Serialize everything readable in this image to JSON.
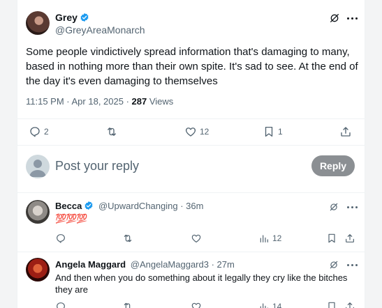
{
  "main_post": {
    "display_name": "Grey",
    "handle": "@GreyAreaMonarch",
    "text": "Some people vindictively spread information that's damaging to many, based in nothing more than their own spite. It's sad to see. At the end of the day it's even damaging to themselves",
    "timestamp": "11:15 PM · Apr 18, 2025 · ",
    "views_count": "287",
    "views_label": " Views",
    "replies": "2",
    "reposts": "",
    "likes": "12",
    "bookmarks": "1"
  },
  "reply_box": {
    "placeholder": "Post your reply",
    "button_label": "Reply"
  },
  "replies": [
    {
      "display_name": "Becca",
      "handle_time": "@UpwardChanging · 36m",
      "text": "💯💯💯",
      "views": "12"
    },
    {
      "display_name": "Angela Maggard",
      "handle_time": "@AngelaMaggard3 · 27m",
      "text": "And then when you do something about it legally they cry like the bitches they are",
      "views": "14"
    }
  ],
  "colors": {
    "verified_blue": "#1d9bf0",
    "reply_button": "#8b8f93",
    "text_secondary": "#536471"
  },
  "icons": [
    "verified-icon",
    "grok-icon",
    "more-icon",
    "reply-icon",
    "repost-icon",
    "like-icon",
    "bookmark-icon",
    "share-icon",
    "views-icon"
  ]
}
